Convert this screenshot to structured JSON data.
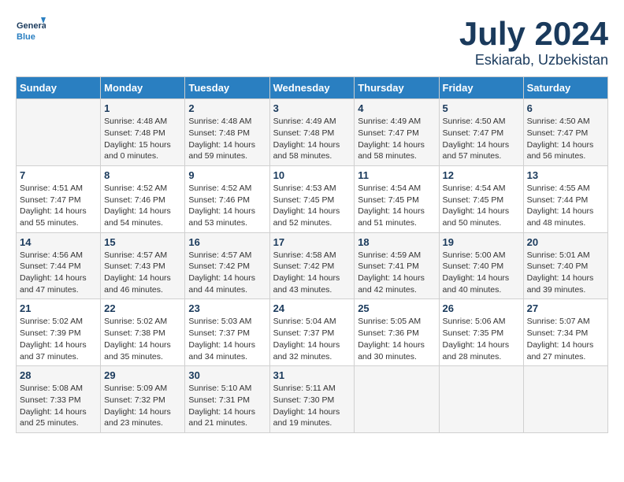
{
  "header": {
    "logo_text_general": "General",
    "logo_text_blue": "Blue",
    "month": "July 2024",
    "location": "Eskiarab, Uzbekistan"
  },
  "days_of_week": [
    "Sunday",
    "Monday",
    "Tuesday",
    "Wednesday",
    "Thursday",
    "Friday",
    "Saturday"
  ],
  "weeks": [
    [
      {
        "day": "",
        "info": ""
      },
      {
        "day": "1",
        "info": "Sunrise: 4:48 AM\nSunset: 7:48 PM\nDaylight: 15 hours\nand 0 minutes."
      },
      {
        "day": "2",
        "info": "Sunrise: 4:48 AM\nSunset: 7:48 PM\nDaylight: 14 hours\nand 59 minutes."
      },
      {
        "day": "3",
        "info": "Sunrise: 4:49 AM\nSunset: 7:48 PM\nDaylight: 14 hours\nand 58 minutes."
      },
      {
        "day": "4",
        "info": "Sunrise: 4:49 AM\nSunset: 7:47 PM\nDaylight: 14 hours\nand 58 minutes."
      },
      {
        "day": "5",
        "info": "Sunrise: 4:50 AM\nSunset: 7:47 PM\nDaylight: 14 hours\nand 57 minutes."
      },
      {
        "day": "6",
        "info": "Sunrise: 4:50 AM\nSunset: 7:47 PM\nDaylight: 14 hours\nand 56 minutes."
      }
    ],
    [
      {
        "day": "7",
        "info": "Sunrise: 4:51 AM\nSunset: 7:47 PM\nDaylight: 14 hours\nand 55 minutes."
      },
      {
        "day": "8",
        "info": "Sunrise: 4:52 AM\nSunset: 7:46 PM\nDaylight: 14 hours\nand 54 minutes."
      },
      {
        "day": "9",
        "info": "Sunrise: 4:52 AM\nSunset: 7:46 PM\nDaylight: 14 hours\nand 53 minutes."
      },
      {
        "day": "10",
        "info": "Sunrise: 4:53 AM\nSunset: 7:45 PM\nDaylight: 14 hours\nand 52 minutes."
      },
      {
        "day": "11",
        "info": "Sunrise: 4:54 AM\nSunset: 7:45 PM\nDaylight: 14 hours\nand 51 minutes."
      },
      {
        "day": "12",
        "info": "Sunrise: 4:54 AM\nSunset: 7:45 PM\nDaylight: 14 hours\nand 50 minutes."
      },
      {
        "day": "13",
        "info": "Sunrise: 4:55 AM\nSunset: 7:44 PM\nDaylight: 14 hours\nand 48 minutes."
      }
    ],
    [
      {
        "day": "14",
        "info": "Sunrise: 4:56 AM\nSunset: 7:44 PM\nDaylight: 14 hours\nand 47 minutes."
      },
      {
        "day": "15",
        "info": "Sunrise: 4:57 AM\nSunset: 7:43 PM\nDaylight: 14 hours\nand 46 minutes."
      },
      {
        "day": "16",
        "info": "Sunrise: 4:57 AM\nSunset: 7:42 PM\nDaylight: 14 hours\nand 44 minutes."
      },
      {
        "day": "17",
        "info": "Sunrise: 4:58 AM\nSunset: 7:42 PM\nDaylight: 14 hours\nand 43 minutes."
      },
      {
        "day": "18",
        "info": "Sunrise: 4:59 AM\nSunset: 7:41 PM\nDaylight: 14 hours\nand 42 minutes."
      },
      {
        "day": "19",
        "info": "Sunrise: 5:00 AM\nSunset: 7:40 PM\nDaylight: 14 hours\nand 40 minutes."
      },
      {
        "day": "20",
        "info": "Sunrise: 5:01 AM\nSunset: 7:40 PM\nDaylight: 14 hours\nand 39 minutes."
      }
    ],
    [
      {
        "day": "21",
        "info": "Sunrise: 5:02 AM\nSunset: 7:39 PM\nDaylight: 14 hours\nand 37 minutes."
      },
      {
        "day": "22",
        "info": "Sunrise: 5:02 AM\nSunset: 7:38 PM\nDaylight: 14 hours\nand 35 minutes."
      },
      {
        "day": "23",
        "info": "Sunrise: 5:03 AM\nSunset: 7:37 PM\nDaylight: 14 hours\nand 34 minutes."
      },
      {
        "day": "24",
        "info": "Sunrise: 5:04 AM\nSunset: 7:37 PM\nDaylight: 14 hours\nand 32 minutes."
      },
      {
        "day": "25",
        "info": "Sunrise: 5:05 AM\nSunset: 7:36 PM\nDaylight: 14 hours\nand 30 minutes."
      },
      {
        "day": "26",
        "info": "Sunrise: 5:06 AM\nSunset: 7:35 PM\nDaylight: 14 hours\nand 28 minutes."
      },
      {
        "day": "27",
        "info": "Sunrise: 5:07 AM\nSunset: 7:34 PM\nDaylight: 14 hours\nand 27 minutes."
      }
    ],
    [
      {
        "day": "28",
        "info": "Sunrise: 5:08 AM\nSunset: 7:33 PM\nDaylight: 14 hours\nand 25 minutes."
      },
      {
        "day": "29",
        "info": "Sunrise: 5:09 AM\nSunset: 7:32 PM\nDaylight: 14 hours\nand 23 minutes."
      },
      {
        "day": "30",
        "info": "Sunrise: 5:10 AM\nSunset: 7:31 PM\nDaylight: 14 hours\nand 21 minutes."
      },
      {
        "day": "31",
        "info": "Sunrise: 5:11 AM\nSunset: 7:30 PM\nDaylight: 14 hours\nand 19 minutes."
      },
      {
        "day": "",
        "info": ""
      },
      {
        "day": "",
        "info": ""
      },
      {
        "day": "",
        "info": ""
      }
    ]
  ]
}
